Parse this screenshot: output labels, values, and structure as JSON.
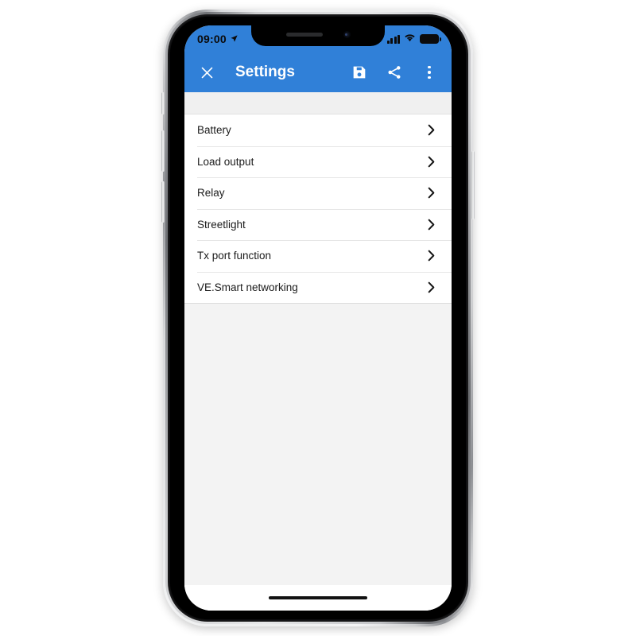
{
  "device": {
    "type": "smartphone-mockup",
    "frame_color": "#e9eaec",
    "bezel_color": "#000000"
  },
  "status_bar": {
    "time": "09:00",
    "location_icon": "location-arrow-icon",
    "signal_icon": "cellular-signal-icon",
    "signal_bars": 4,
    "wifi_icon": "wifi-icon",
    "battery_icon": "battery-full-icon",
    "background_color": "#3080d8",
    "icon_color": "#0b0b0c"
  },
  "app_bar": {
    "title": "Settings",
    "background_color": "#3080d8",
    "text_color": "#ffffff",
    "close_icon": "close-icon",
    "actions": [
      {
        "name": "save-button",
        "icon": "save-floppy-icon"
      },
      {
        "name": "share-button",
        "icon": "share-icon"
      },
      {
        "name": "overflow-menu-button",
        "icon": "more-vertical-icon"
      }
    ]
  },
  "settings_list": {
    "chevron_icon": "chevron-right-icon",
    "items": [
      {
        "label": "Battery"
      },
      {
        "label": "Load output"
      },
      {
        "label": "Relay"
      },
      {
        "label": "Streetlight"
      },
      {
        "label": "Tx port function"
      },
      {
        "label": "VE.Smart networking"
      }
    ]
  },
  "home_indicator": {
    "name": "home-indicator"
  }
}
